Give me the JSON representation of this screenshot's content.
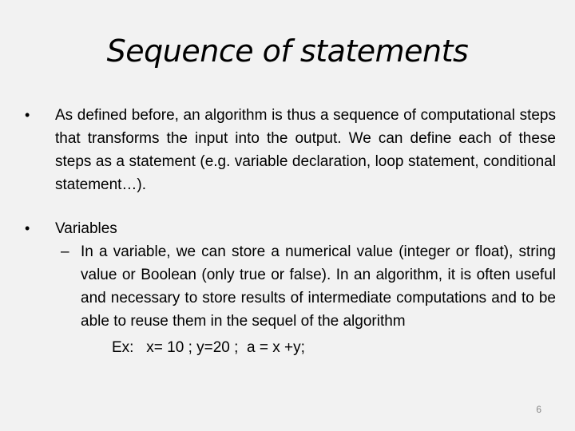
{
  "slide": {
    "title": "Sequence of statements",
    "bullets": [
      {
        "marker": "•",
        "text": "As defined before, an algorithm is thus a sequence of computational steps that transforms the input into the output. We can define each of these steps as a statement (e.g. variable declaration, loop statement, conditional statement…)."
      },
      {
        "marker": "•",
        "text": "Variables",
        "sub_items": [
          {
            "marker": "–",
            "text": "In a variable, we can store a numerical value (integer or float), string value or Boolean (only true or false). In an algorithm, it is often useful and necessary to store results of intermediate computations and to be able to reuse them in the sequel of the algorithm"
          }
        ],
        "example": "Ex:   x= 10 ; y=20 ;  a = x +y;"
      }
    ],
    "page_number": "6"
  }
}
